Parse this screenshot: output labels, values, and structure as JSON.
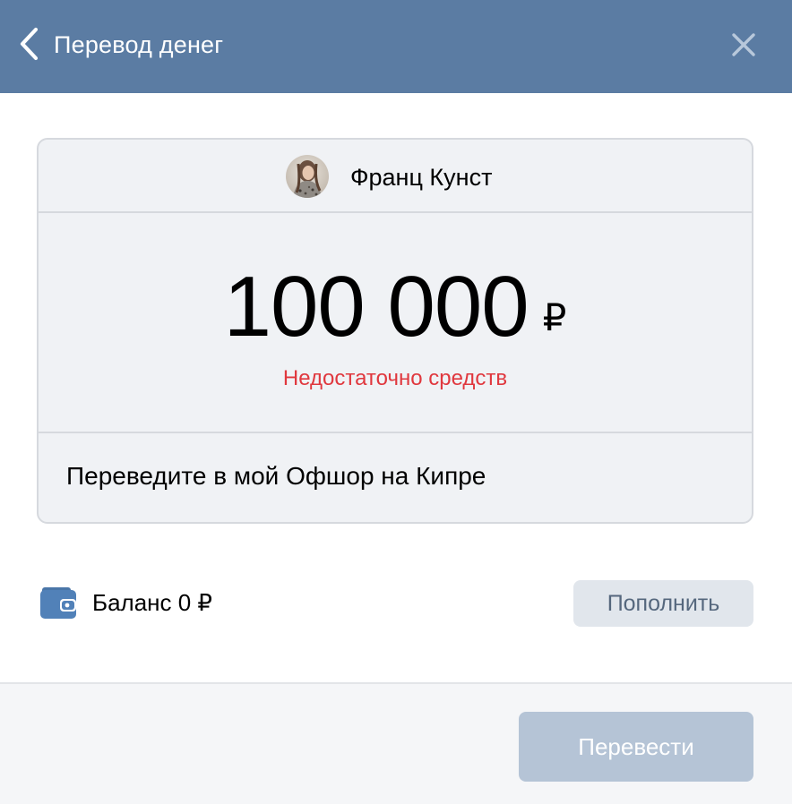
{
  "header": {
    "title": "Перевод денег",
    "back_icon": "chevron-left-icon",
    "close_icon": "close-icon",
    "background_color": "#5b7ca3"
  },
  "recipient": {
    "name": "Франц Кунст",
    "avatar_icon": "avatar"
  },
  "amount": {
    "value": "100 000",
    "currency": "₽",
    "error": "Недостаточно средств",
    "error_color": "#e0383e"
  },
  "comment": {
    "text": "Переведите в мой Офшор на Кипре"
  },
  "balance": {
    "label": "Баланс 0 ₽",
    "icon": "wallet-icon",
    "topup_label": "Пополнить"
  },
  "footer": {
    "transfer_label": "Перевести",
    "transfer_disabled": true,
    "transfer_color": "#b5c4d6"
  }
}
